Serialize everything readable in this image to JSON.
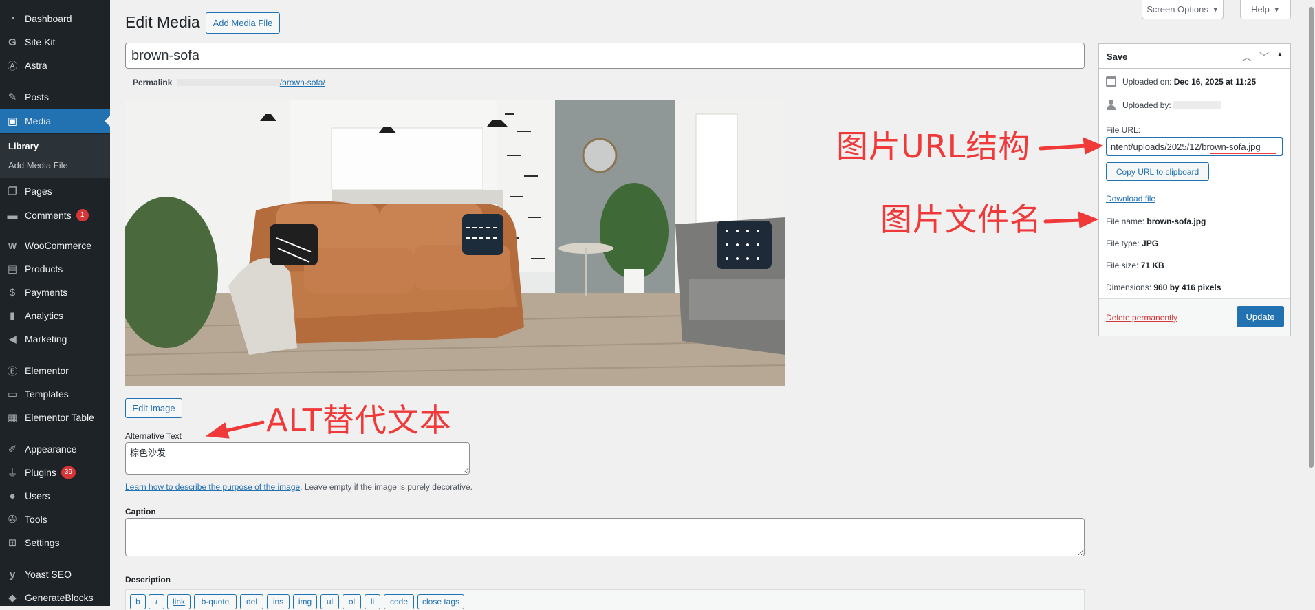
{
  "sidebar": {
    "items": [
      {
        "label": "Dashboard",
        "icon": "dashboard-icon"
      },
      {
        "label": "Site Kit",
        "icon": "sitekit-icon"
      },
      {
        "label": "Astra",
        "icon": "astra-icon"
      },
      {
        "label": "Posts",
        "icon": "pin-icon"
      },
      {
        "label": "Media",
        "icon": "media-icon"
      },
      {
        "label": "Pages",
        "icon": "pages-icon"
      },
      {
        "label": "Comments",
        "icon": "comment-icon",
        "badge": "1"
      },
      {
        "label": "WooCommerce",
        "icon": "woo-icon"
      },
      {
        "label": "Products",
        "icon": "products-icon"
      },
      {
        "label": "Payments",
        "icon": "dollar-icon"
      },
      {
        "label": "Analytics",
        "icon": "bar-chart-icon"
      },
      {
        "label": "Marketing",
        "icon": "megaphone-icon"
      },
      {
        "label": "Elementor",
        "icon": "elementor-icon"
      },
      {
        "label": "Templates",
        "icon": "folder-icon"
      },
      {
        "label": "Elementor Table",
        "icon": "table-icon"
      },
      {
        "label": "Appearance",
        "icon": "brush-icon"
      },
      {
        "label": "Plugins",
        "icon": "plug-icon",
        "badge": "39"
      },
      {
        "label": "Users",
        "icon": "user-icon"
      },
      {
        "label": "Tools",
        "icon": "wrench-icon"
      },
      {
        "label": "Settings",
        "icon": "settings-icon"
      },
      {
        "label": "Yoast SEO",
        "icon": "yoast-icon"
      },
      {
        "label": "GenerateBlocks",
        "icon": "blocks-icon"
      }
    ],
    "submenu": {
      "library": "Library",
      "add_media_file": "Add Media File"
    }
  },
  "header": {
    "title": "Edit Media",
    "add_media_button": "Add Media File",
    "screen_options": "Screen Options",
    "help": "Help"
  },
  "post": {
    "title_value": "brown-sofa",
    "permalink_label": "Permalink",
    "permalink_slug": "/brown-sofa/"
  },
  "image": {
    "alt": "brown leather sofa in a bright living room"
  },
  "edit_image_button": "Edit Image",
  "alt_text": {
    "label": "Alternative Text",
    "value": "棕色沙发",
    "help_link": "Learn how to describe the purpose of the image",
    "help_rest": ". Leave empty if the image is purely decorative."
  },
  "caption": {
    "label": "Caption",
    "value": ""
  },
  "description": {
    "label": "Description",
    "toolbar": [
      "b",
      "i",
      "link",
      "b-quote",
      "del",
      "ins",
      "img",
      "ul",
      "ol",
      "li",
      "code",
      "close tags"
    ]
  },
  "save_box": {
    "title": "Save",
    "uploaded_on_label": "Uploaded on:",
    "uploaded_on_value": "Dec 16, 2025 at 11:25",
    "uploaded_by_label": "Uploaded by:",
    "file_url_label": "File URL:",
    "file_url_value": "ntent/uploads/2025/12/brown-sofa.jpg",
    "copy_url_button": "Copy URL to clipboard",
    "download_link": "Download file",
    "file_name_label": "File name:",
    "file_name_value": "brown-sofa.jpg",
    "file_type_label": "File type:",
    "file_type_value": "JPG",
    "file_size_label": "File size:",
    "file_size_value": "71 KB",
    "dimensions_label": "Dimensions:",
    "dimensions_value": "960 by 416 pixels",
    "delete_link": "Delete permanently",
    "update_button": "Update"
  },
  "annotations": {
    "url_structure": "图片URL结构",
    "file_name": "图片文件名",
    "alt_text": "ALT替代文本"
  },
  "colors": {
    "accent": "#2271b1",
    "annotation": "#f03a3a",
    "sidebar": "#1d2327"
  }
}
